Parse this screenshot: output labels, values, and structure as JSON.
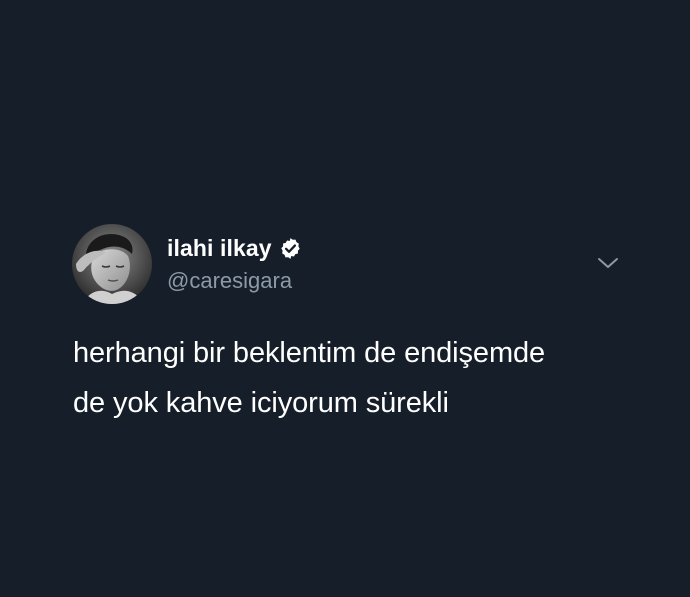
{
  "tweet": {
    "author": {
      "display_name": "ilahi ilkay",
      "handle": "@caresigara",
      "verified": true,
      "avatar_icon": "profile-photo"
    },
    "text_lines": [
      "herhangi bir beklentim de endişemde",
      "de yok kahve iciyorum sürekli"
    ],
    "menu_icon": "chevron-down-icon"
  },
  "colors": {
    "background": "#161f29",
    "text": "#ffffff",
    "handle": "#8c99a6",
    "chevron": "#8c99a6"
  }
}
